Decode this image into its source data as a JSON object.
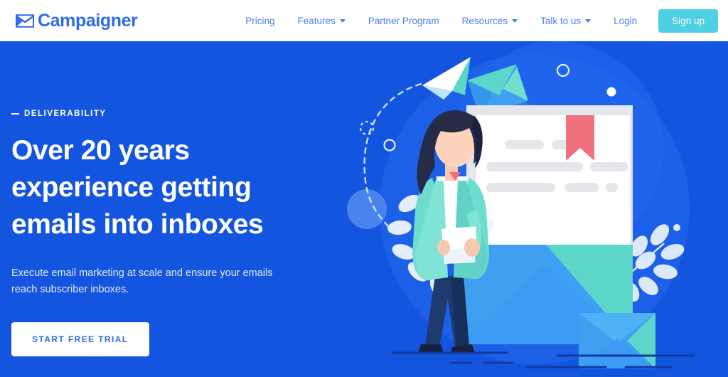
{
  "header": {
    "logo": {
      "text": "Campaigner",
      "icon": "envelope-logo-icon"
    },
    "nav": [
      {
        "label": "Pricing",
        "has_caret": false
      },
      {
        "label": "Features",
        "has_caret": true
      },
      {
        "label": "Partner Program",
        "has_caret": false
      },
      {
        "label": "Resources",
        "has_caret": true
      },
      {
        "label": "Talk to us",
        "has_caret": true
      },
      {
        "label": "Login",
        "has_caret": false
      }
    ],
    "signup_label": "Sign up"
  },
  "hero": {
    "eyebrow": "DELIVERABILITY",
    "title": "Over 20 years experience getting emails into inboxes",
    "subtitle": "Execute email marketing at scale and ensure your emails reach subscriber inboxes.",
    "cta_label": "START FREE TRIAL"
  },
  "colors": {
    "brand_blue": "#2E6BEB",
    "hero_background": "#1455E0",
    "signup_teal": "#4FCFE2",
    "cta_white": "#FFFFFF",
    "nav_link": "#4A7DF0",
    "accent_teal": "#5CD6C8",
    "accent_light_blue": "#3FA0F0",
    "ribbon_red": "#F0707E"
  },
  "illustration": {
    "name": "email-deliverability-illustration",
    "elements": [
      "paper-plane-icon",
      "dashed-flight-path",
      "woman-figure",
      "open-envelope-with-letter",
      "floating-envelope-icon",
      "small-envelope-icon",
      "leaf-fronds",
      "decorative-circles",
      "bookmark-ribbon"
    ]
  }
}
